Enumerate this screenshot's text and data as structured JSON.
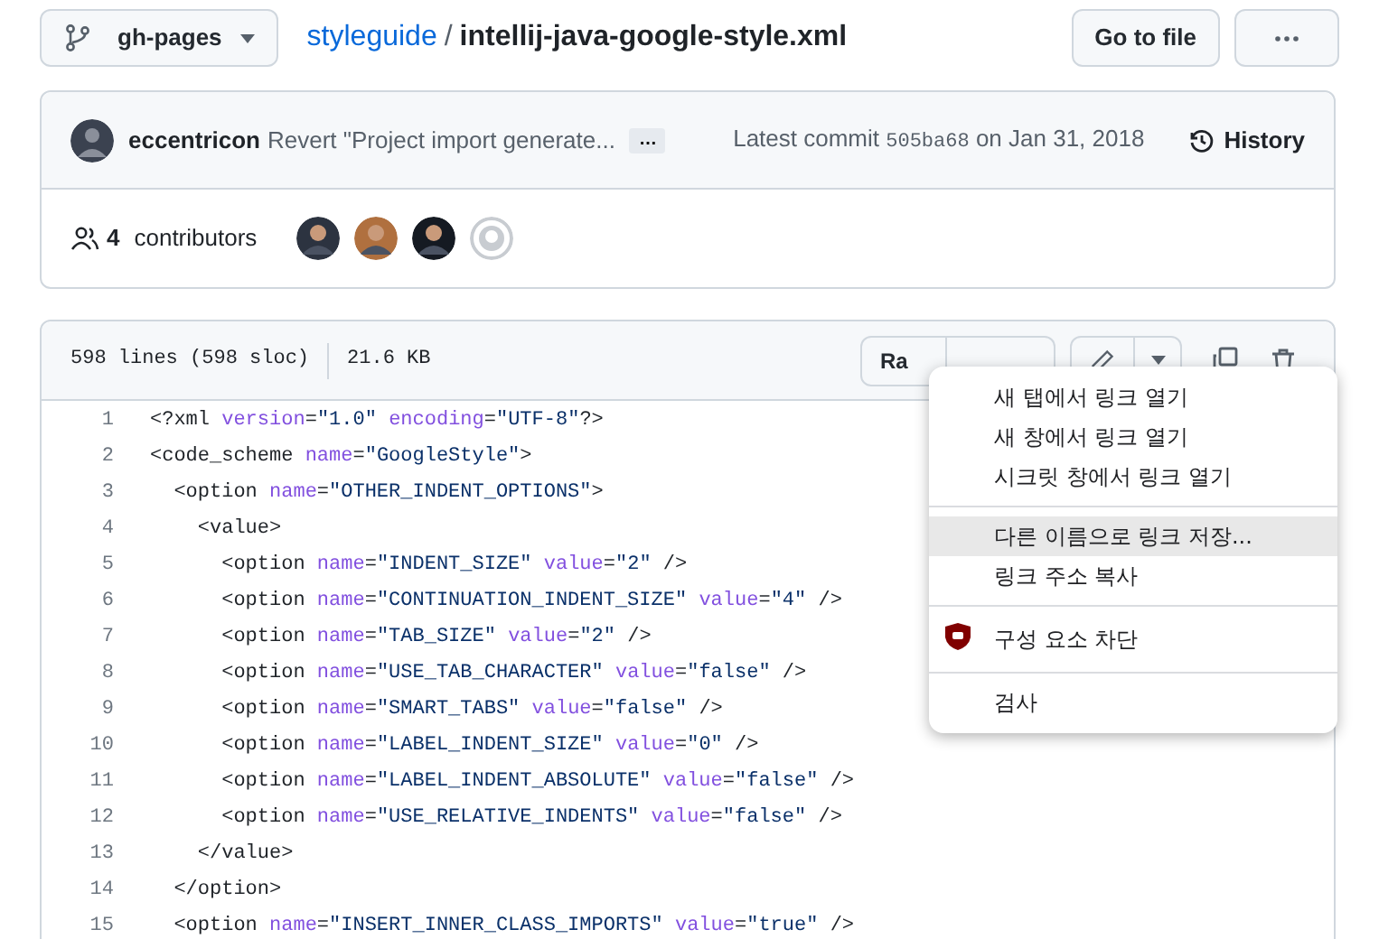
{
  "branch": "gh-pages",
  "breadcrumb": {
    "repo": "styleguide",
    "separator": "/",
    "file": "intellij-java-google-style.xml"
  },
  "go_to_file": "Go to file",
  "commit": {
    "author": "eccentricon",
    "message": "Revert \"Project import generate...",
    "more": "…",
    "latest_label": "Latest commit",
    "sha": "505ba68",
    "date": "on Jan 31, 2018",
    "history": "History"
  },
  "contributors": {
    "count": "4",
    "label": "contributors",
    "avatars": [
      {
        "kind": "photo"
      },
      {
        "kind": "photo"
      },
      {
        "kind": "photo"
      },
      {
        "kind": "default"
      }
    ]
  },
  "file_info": {
    "lines": "598 lines (598 sloc)",
    "size": "21.6 KB"
  },
  "view_buttons": [
    "Ra"
  ],
  "code_lines": [
    {
      "n": "1",
      "text": "<?xml version=\"1.0\" encoding=\"UTF-8\"?>"
    },
    {
      "n": "2",
      "text": "<code_scheme name=\"GoogleStyle\">"
    },
    {
      "n": "3",
      "text": "  <option name=\"OTHER_INDENT_OPTIONS\">"
    },
    {
      "n": "4",
      "text": "    <value>"
    },
    {
      "n": "5",
      "text": "      <option name=\"INDENT_SIZE\" value=\"2\" />"
    },
    {
      "n": "6",
      "text": "      <option name=\"CONTINUATION_INDENT_SIZE\" value=\"4\" />"
    },
    {
      "n": "7",
      "text": "      <option name=\"TAB_SIZE\" value=\"2\" />"
    },
    {
      "n": "8",
      "text": "      <option name=\"USE_TAB_CHARACTER\" value=\"false\" />"
    },
    {
      "n": "9",
      "text": "      <option name=\"SMART_TABS\" value=\"false\" />"
    },
    {
      "n": "10",
      "text": "      <option name=\"LABEL_INDENT_SIZE\" value=\"0\" />"
    },
    {
      "n": "11",
      "text": "      <option name=\"LABEL_INDENT_ABSOLUTE\" value=\"false\" />"
    },
    {
      "n": "12",
      "text": "      <option name=\"USE_RELATIVE_INDENTS\" value=\"false\" />"
    },
    {
      "n": "13",
      "text": "    </value>"
    },
    {
      "n": "14",
      "text": "  </option>"
    },
    {
      "n": "15",
      "text": "  <option name=\"INSERT_INNER_CLASS_IMPORTS\" value=\"true\" />"
    }
  ],
  "context_menu": [
    [
      {
        "label": "새 탭에서 링크 열기",
        "kind": "plain",
        "selected": false
      },
      {
        "label": "새 창에서 링크 열기",
        "kind": "plain",
        "selected": false
      },
      {
        "label": "시크릿 창에서 링크 열기",
        "kind": "plain",
        "selected": false
      }
    ],
    [
      {
        "label": "다른 이름으로 링크 저장...",
        "kind": "plain",
        "selected": true
      },
      {
        "label": "링크 주소 복사",
        "kind": "plain",
        "selected": false
      }
    ],
    [
      {
        "label": "구성 요소 차단",
        "kind": "extension",
        "selected": false
      }
    ],
    [
      {
        "label": "검사",
        "kind": "plain",
        "selected": false
      }
    ]
  ]
}
